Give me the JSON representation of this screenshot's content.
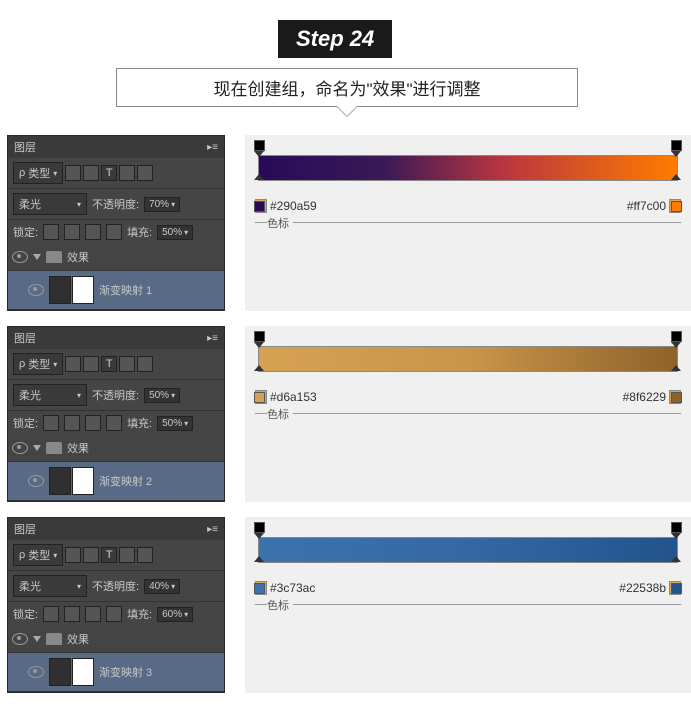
{
  "header": {
    "step": "Step 24",
    "instruction": "现在创建组，命名为\"效果\"进行调整"
  },
  "panels": [
    {
      "title": "图层",
      "type": "类型",
      "blend": "柔光",
      "opacity_label": "不透明度:",
      "opacity": "70%",
      "lock_label": "锁定:",
      "fill_label": "填充:",
      "fill": "50%",
      "group": "效果",
      "layer": "渐变映射 1"
    },
    {
      "title": "图层",
      "type": "类型",
      "blend": "柔光",
      "opacity_label": "不透明度:",
      "opacity": "50%",
      "lock_label": "锁定:",
      "fill_label": "填充:",
      "fill": "50%",
      "group": "效果",
      "layer": "渐变映射 2"
    },
    {
      "title": "图层",
      "type": "类型",
      "blend": "柔光",
      "opacity_label": "不透明度:",
      "opacity": "40%",
      "lock_label": "锁定:",
      "fill_label": "填充:",
      "fill": "60%",
      "group": "效果",
      "layer": "渐变映射 3"
    }
  ],
  "gradients": [
    {
      "c1": "#290a59",
      "c2": "#ff7c00",
      "label": "色标",
      "css": "linear-gradient(90deg,#290a59 0%,#3a1956 30%,#b83540 58%,#ff7c00 100%)"
    },
    {
      "c1": "#d6a153",
      "c2": "#8f6229",
      "label": "色标",
      "css": "linear-gradient(90deg,#d6a153 0%,#c8954a 50%,#8f6229 100%)"
    },
    {
      "c1": "#3c73ac",
      "c2": "#22538b",
      "label": "色标",
      "css": "linear-gradient(90deg,#3c73ac 0%,#3568a2 50%,#22538b 100%)"
    }
  ],
  "chart_data": [
    {
      "type": "table",
      "title": "Gradient 1 stops",
      "categories": [
        "left",
        "right"
      ],
      "values": [
        "#290a59",
        "#ff7c00"
      ]
    },
    {
      "type": "table",
      "title": "Gradient 2 stops",
      "categories": [
        "left",
        "right"
      ],
      "values": [
        "#d6a153",
        "#8f6229"
      ]
    },
    {
      "type": "table",
      "title": "Gradient 3 stops",
      "categories": [
        "left",
        "right"
      ],
      "values": [
        "#3c73ac",
        "#22538b"
      ]
    }
  ]
}
